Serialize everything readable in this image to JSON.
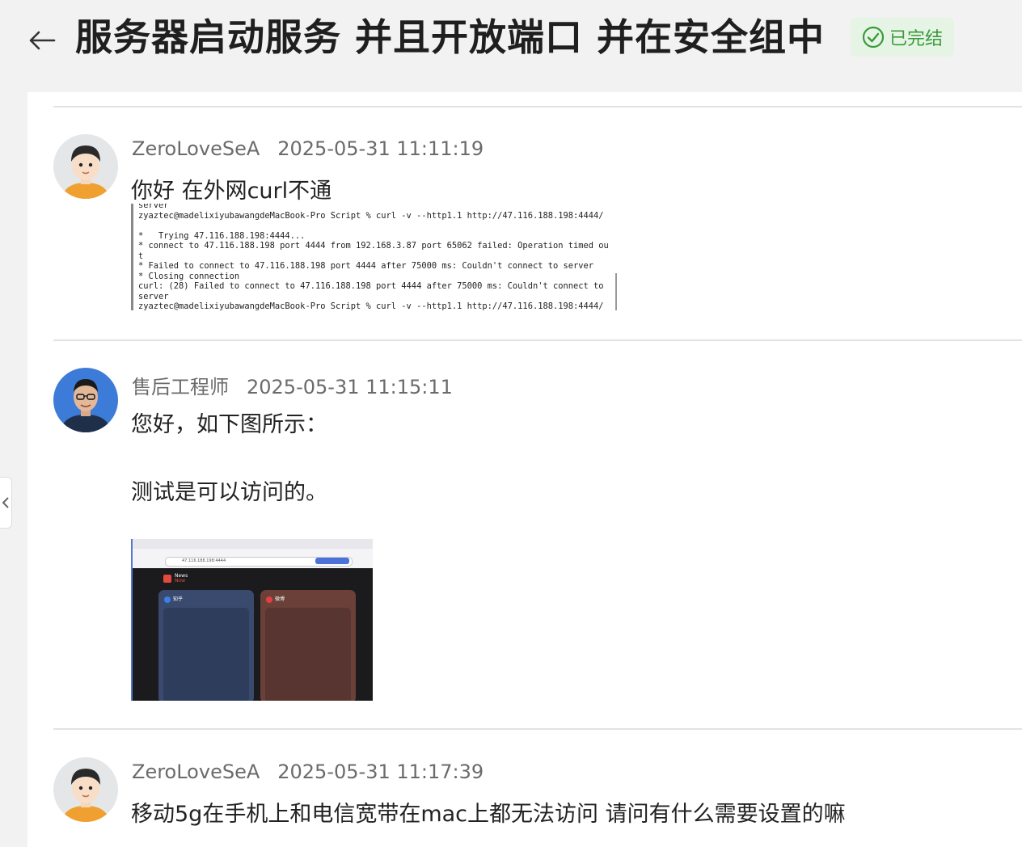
{
  "header": {
    "back_label": "←",
    "title": "服务器启动服务 并且开放端口 并在安全组中",
    "status": "已完结"
  },
  "messages": [
    {
      "author": "ZeroLoveSeA",
      "time": "2025-05-31 11:11:19",
      "text": "你好 在外网curl不通",
      "attachment_terminal": {
        "lines": [
          "server",
          "zyaztec@madelixiyubawangdeMacBook-Pro Script % curl -v --http1.1 http://47.116.188.198:4444/",
          "",
          "*   Trying 47.116.188.198:4444...",
          "* connect to 47.116.188.198 port 4444 from 192.168.3.87 port 65062 failed: Operation timed ou",
          "t",
          "* Failed to connect to 47.116.188.198 port 4444 after 75000 ms: Couldn't connect to server",
          "* Closing connection",
          "curl: (28) Failed to connect to 47.116.188.198 port 4444 after 75000 ms: Couldn't connect to",
          "server",
          "zyaztec@madelixiyubawangdeMacBook-Pro Script % curl -v --http1.1 http://47.116.188.198:4444/"
        ]
      }
    },
    {
      "author": "售后工程师",
      "time": "2025-05-31 11:15:11",
      "text_line1": "您好，如下图所示：",
      "text_line2": "测试是可以访问的。",
      "attachment_screenshot": {
        "address": "47.116.188.198:4444",
        "logo_line1": "News",
        "logo_line2": "Now",
        "card1_title": "知乎",
        "card2_title": "微博"
      }
    },
    {
      "author": "ZeroLoveSeA",
      "time": "2025-05-31 11:17:39",
      "text": "移动5g在手机上和电信宽带在mac上都无法访问 请问有什么需要设置的嘛"
    }
  ],
  "colors": {
    "accent_green": "#3a9a3a",
    "badge_bg": "#e6f4e6"
  }
}
